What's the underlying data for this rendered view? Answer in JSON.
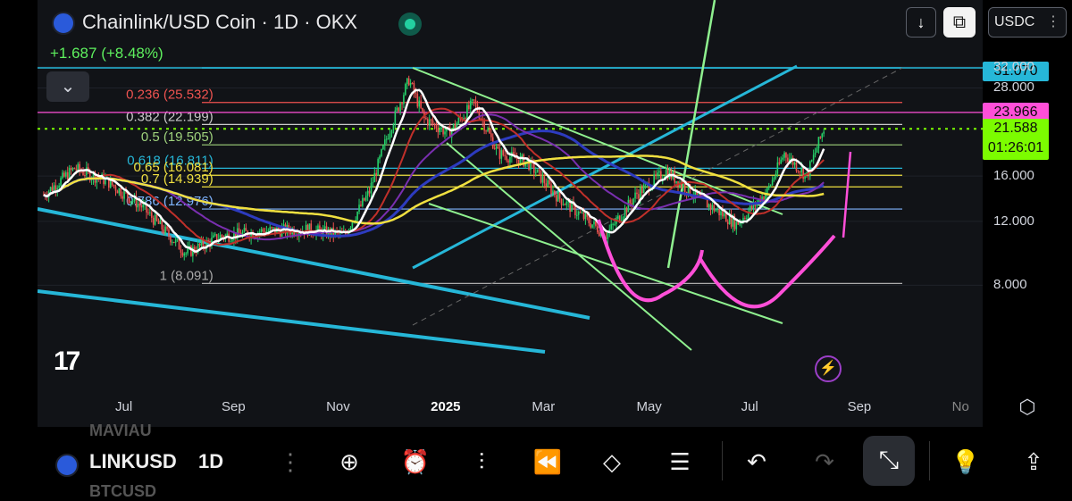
{
  "header": {
    "title": "Chainlink/USD Coin · 1D · OKX",
    "change": "+1.687 (+8.48%)",
    "currency": "USDC",
    "currency_menu": "⋮"
  },
  "colors": {
    "bg": "#111317",
    "up": "#26d26a",
    "down": "#ef5350",
    "fib_red": "#ef5350",
    "magenta": "#ff4fd8",
    "cyan": "#26b7d8",
    "lightgreen": "#8ff08f",
    "yellow": "#f0e040",
    "white": "#ffffff"
  },
  "chart_data": {
    "type": "candlestick",
    "title": "Chainlink/USD Coin · 1D · OKX",
    "y_axis": {
      "ticks": [
        "32.000",
        "28.000",
        "16.000",
        "12.000",
        "8.000"
      ],
      "tick_values": [
        32,
        28,
        16,
        12,
        8
      ],
      "scale": "log",
      "range": [
        7,
        34
      ]
    },
    "x_axis": {
      "ticks": [
        "Jul",
        "Sep",
        "Nov",
        "2025",
        "Mar",
        "May",
        "Jul",
        "Sep",
        "No"
      ],
      "tick_dates": [
        "2024-07-01",
        "2024-09-01",
        "2024-11-01",
        "2025-01-01",
        "2025-03-01",
        "2025-05-01",
        "2025-07-01",
        "2025-09-01",
        "2025-11-01"
      ],
      "range": [
        "2024-05-14",
        "2025-11-20"
      ]
    },
    "price_tags": [
      {
        "value": "31.070",
        "color": "#26b7d8",
        "text_color": "#0b0b0b"
      },
      {
        "value": "23.966",
        "color": "#ff4fd8",
        "text_color": "#0b0b0b"
      },
      {
        "value": "21.588",
        "sub": "01:26:01",
        "color": "#7cfc00",
        "text_color": "#0b0b0b"
      }
    ],
    "fib_levels": [
      {
        "label": "0.236 (25.532)",
        "value": 25.532,
        "color": "#ef5350"
      },
      {
        "label": "0.382 (22.199)",
        "value": 22.199,
        "color": "#c9c9c9"
      },
      {
        "label": "0.5 (19.505)",
        "value": 19.505,
        "color": "#9fd27c"
      },
      {
        "label": "0.618 (16.811)",
        "value": 16.811,
        "color": "#26b7d8"
      },
      {
        "label": "0.65 (16.081)",
        "value": 16.081,
        "color": "#f0e040"
      },
      {
        "label": "0.7 (14.939)",
        "value": 14.939,
        "color": "#f0e040"
      },
      {
        "label": "0.786 (12.976)",
        "value": 12.976,
        "color": "#7fb5ff"
      },
      {
        "label": "1 (8.091)",
        "value": 8.091,
        "color": "#aaaaaa"
      }
    ],
    "ohlc_closes": [
      {
        "date": "2024-05-14",
        "close": 14.2
      },
      {
        "date": "2024-06-01",
        "close": 16.8
      },
      {
        "date": "2024-06-20",
        "close": 15.5
      },
      {
        "date": "2024-07-10",
        "close": 13.2
      },
      {
        "date": "2024-08-05",
        "close": 9.8
      },
      {
        "date": "2024-08-25",
        "close": 10.9
      },
      {
        "date": "2024-09-20",
        "close": 11.3
      },
      {
        "date": "2024-10-15",
        "close": 11.4
      },
      {
        "date": "2024-11-05",
        "close": 11.0
      },
      {
        "date": "2024-11-20",
        "close": 14.5
      },
      {
        "date": "2024-12-01",
        "close": 21.0
      },
      {
        "date": "2024-12-13",
        "close": 29.5
      },
      {
        "date": "2024-12-22",
        "close": 23.0
      },
      {
        "date": "2025-01-05",
        "close": 21.0
      },
      {
        "date": "2025-01-20",
        "close": 25.5
      },
      {
        "date": "2025-02-03",
        "close": 18.5
      },
      {
        "date": "2025-02-20",
        "close": 17.5
      },
      {
        "date": "2025-03-10",
        "close": 14.0
      },
      {
        "date": "2025-04-07",
        "close": 11.0
      },
      {
        "date": "2025-04-25",
        "close": 14.3
      },
      {
        "date": "2025-05-12",
        "close": 16.5
      },
      {
        "date": "2025-05-30",
        "close": 14.0
      },
      {
        "date": "2025-06-22",
        "close": 11.8
      },
      {
        "date": "2025-07-10",
        "close": 14.5
      },
      {
        "date": "2025-07-20",
        "close": 18.5
      },
      {
        "date": "2025-08-02",
        "close": 16.0
      },
      {
        "date": "2025-08-12",
        "close": 21.588
      }
    ]
  },
  "toolbar": {
    "symbol": "LINKUSD",
    "ghost_above": "MAVIAU",
    "ghost_below": "BTCUSD",
    "interval": "1D"
  }
}
